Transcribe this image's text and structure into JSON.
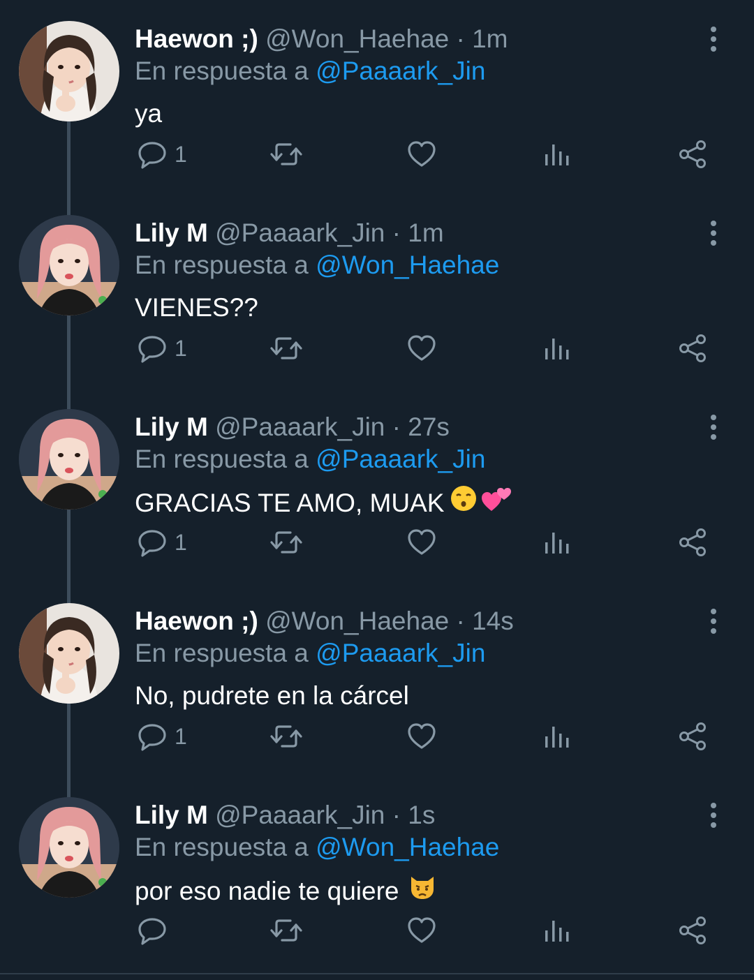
{
  "reply_prefix": "En respuesta a",
  "tweets": [
    {
      "avatar": "haewon-avatar",
      "name": "Haewon ;)",
      "handle": "@Won_Haehae",
      "time": "1m",
      "reply_to": "@Paaaark_Jin",
      "text": "ya",
      "emojis": [],
      "reply_count": "1"
    },
    {
      "avatar": "lily-avatar",
      "name": "Lily M",
      "handle": "@Paaaark_Jin",
      "time": "1m",
      "reply_to": "@Won_Haehae",
      "text": "VIENES??",
      "emojis": [],
      "reply_count": "1"
    },
    {
      "avatar": "lily-avatar",
      "name": "Lily M",
      "handle": "@Paaaark_Jin",
      "time": "27s",
      "reply_to": "@Paaaark_Jin",
      "text": "GRACIAS TE AMO, MUAK",
      "emojis": [
        "kissing-face-emoji",
        "two-hearts-emoji"
      ],
      "reply_count": "1"
    },
    {
      "avatar": "haewon-avatar",
      "name": "Haewon ;)",
      "handle": "@Won_Haehae",
      "time": "14s",
      "reply_to": "@Paaaark_Jin",
      "text": "No, pudrete en la cárcel",
      "emojis": [],
      "reply_count": "1"
    },
    {
      "avatar": "lily-avatar",
      "name": "Lily M",
      "handle": "@Paaaark_Jin",
      "time": "1s",
      "reply_to": "@Won_Haehae",
      "text": "por eso nadie te quiere",
      "emojis": [
        "pouting-cat-emoji"
      ],
      "reply_count": ""
    }
  ],
  "icons": {
    "reply": "reply-icon",
    "retweet": "retweet-icon",
    "like": "heart-icon",
    "analytics": "analytics-icon",
    "share": "share-icon",
    "more": "more-options-icon"
  },
  "colors": {
    "background": "#15202b",
    "text": "#ffffff",
    "secondary": "#8899a6",
    "link": "#1d9bf0",
    "thread_line": "#3d4d5c"
  }
}
